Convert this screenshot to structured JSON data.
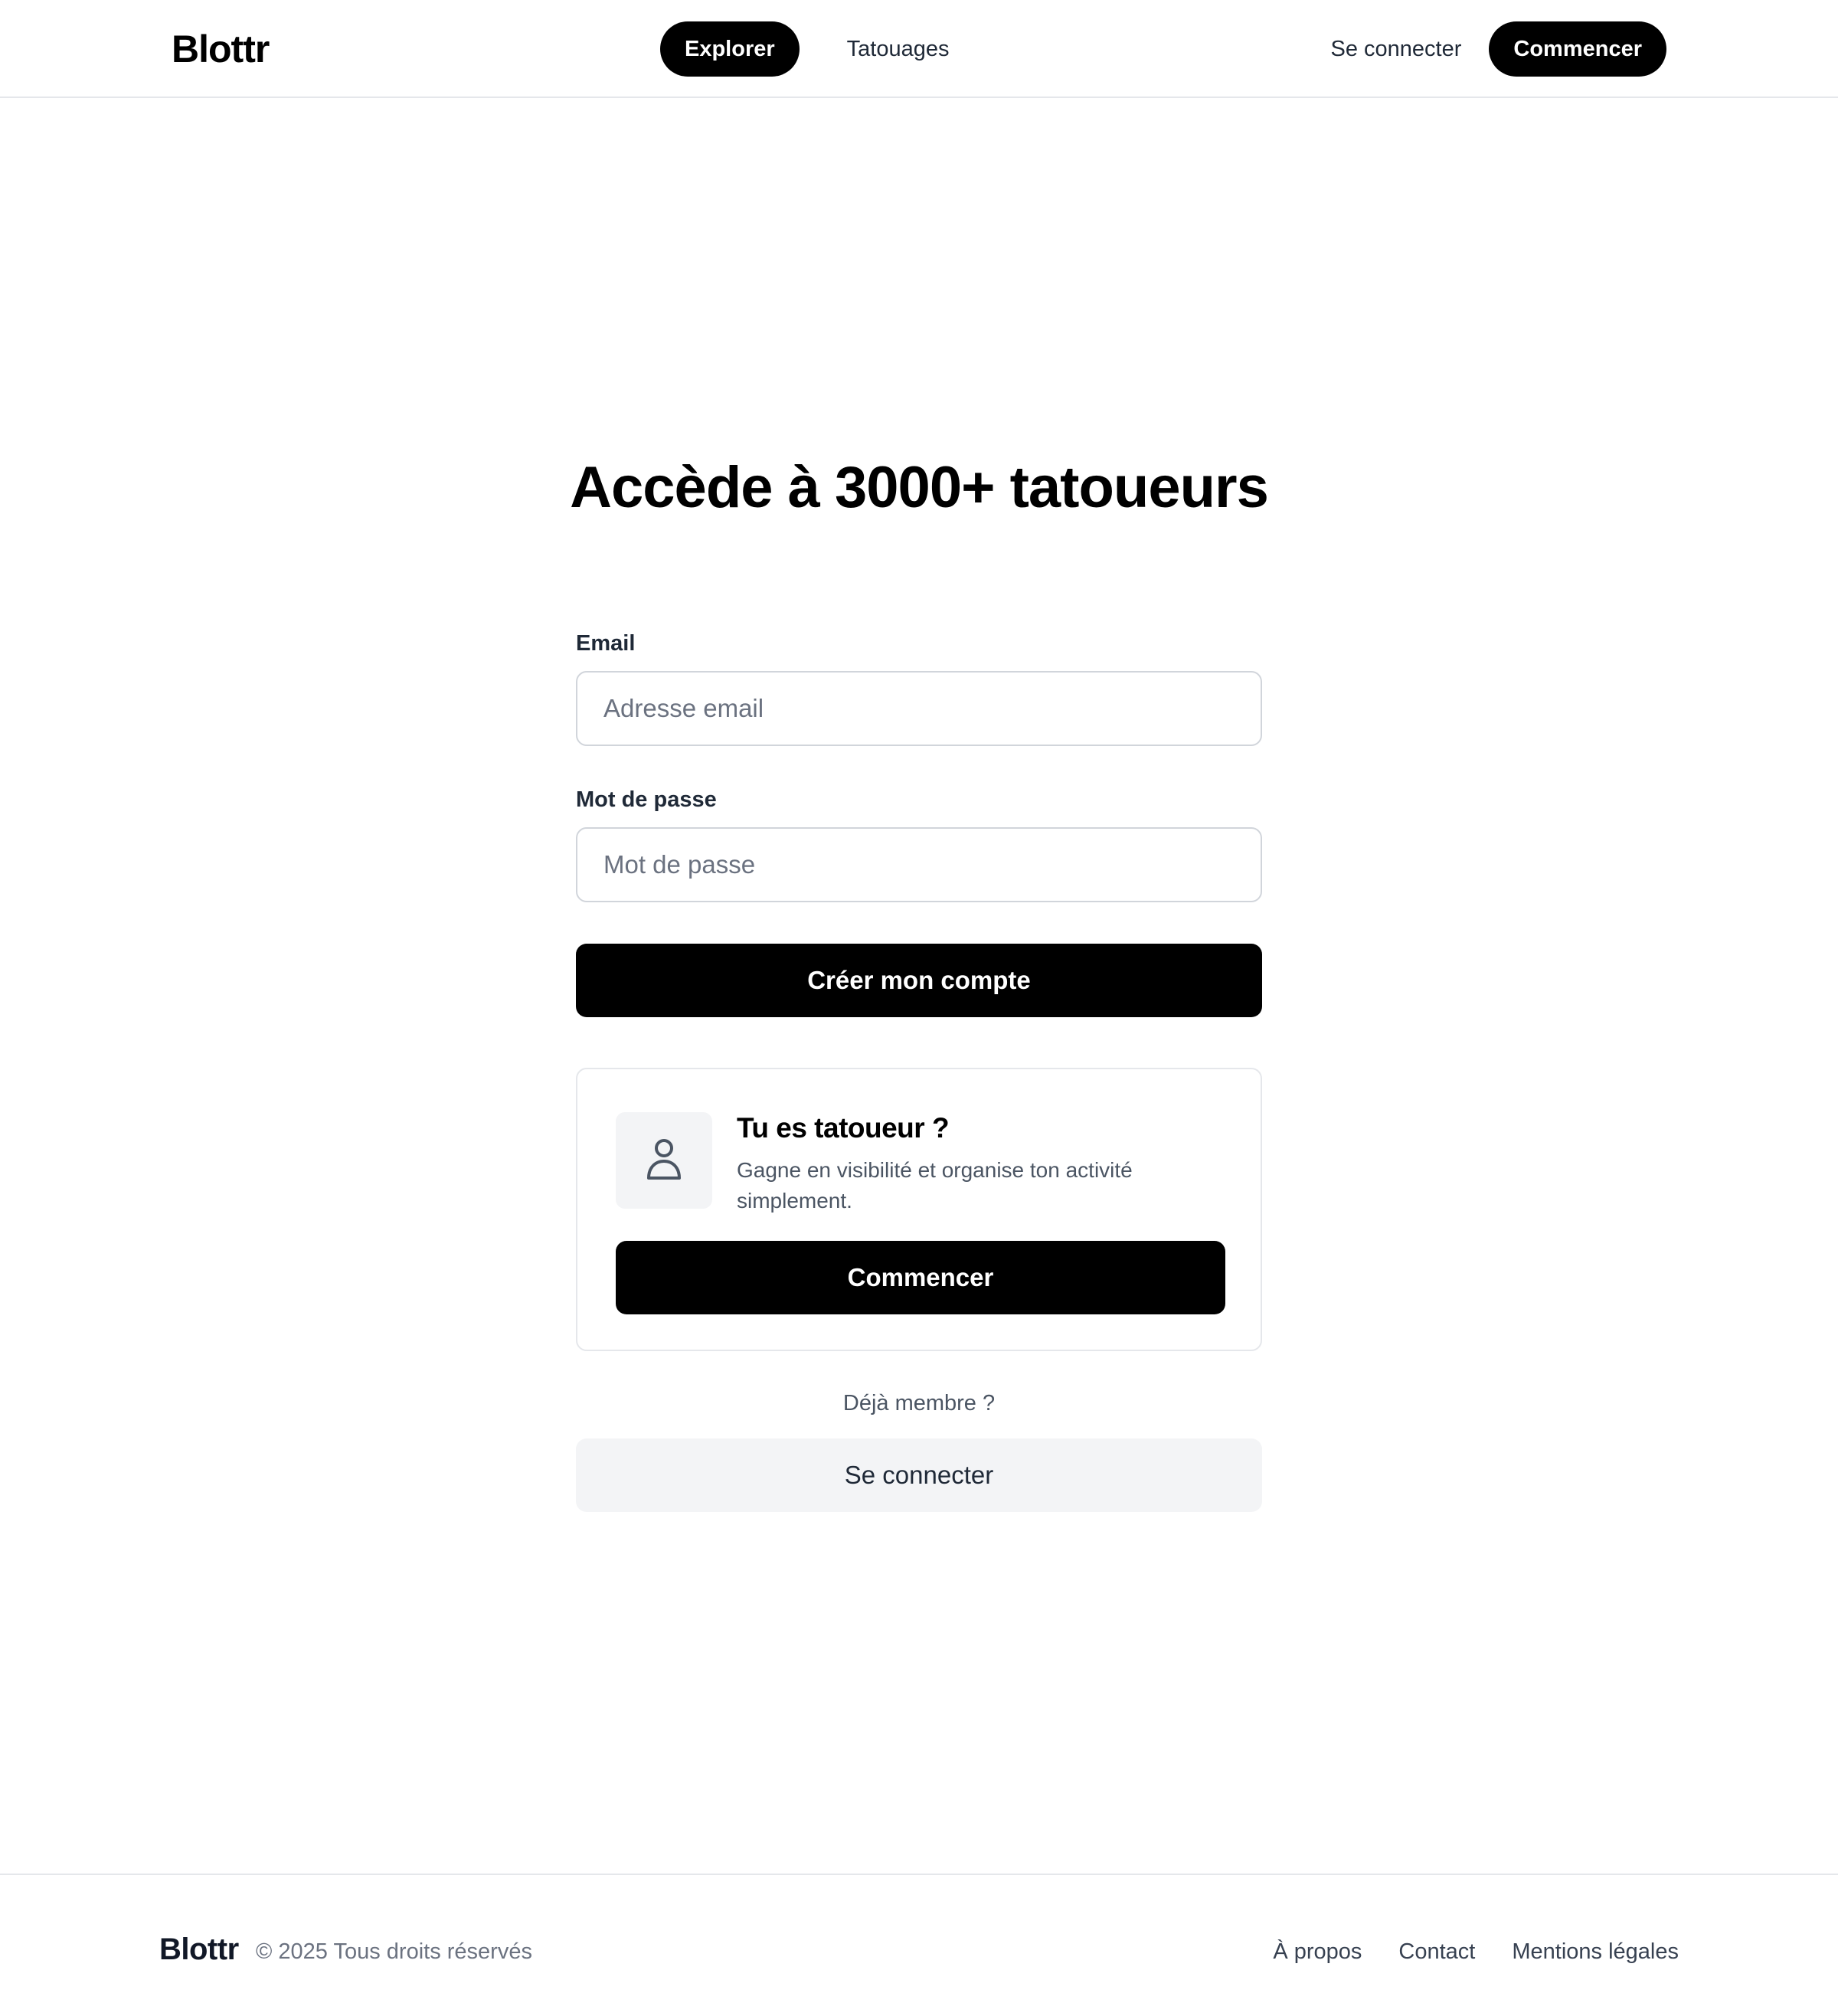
{
  "header": {
    "logo": "Blottr",
    "nav": {
      "explore_label": "Explorer",
      "tattoos_label": "Tatouages"
    },
    "login_label": "Se connecter",
    "start_label": "Commencer"
  },
  "main": {
    "title": "Accède à 3000+ tatoueurs",
    "email": {
      "label": "Email",
      "placeholder": "Adresse email",
      "value": ""
    },
    "password": {
      "label": "Mot de passe",
      "placeholder": "Mot de passe",
      "value": ""
    },
    "create_account_label": "Créer mon compte",
    "artist_card": {
      "icon": "user-icon",
      "title": "Tu es tatoueur ?",
      "description": "Gagne en visibilité et organise ton activité simplement.",
      "button_label": "Commencer"
    },
    "already_member": "Déjà membre ?",
    "login_button_label": "Se connecter"
  },
  "footer": {
    "logo": "Blottr",
    "copyright": "© 2025 Tous droits réservés",
    "links": [
      "À propos",
      "Contact",
      "Mentions légales"
    ]
  },
  "colors": {
    "primary": "#000000",
    "secondary_bg": "#f3f4f6",
    "border": "#d1d5db",
    "muted_text": "#6b7280"
  }
}
